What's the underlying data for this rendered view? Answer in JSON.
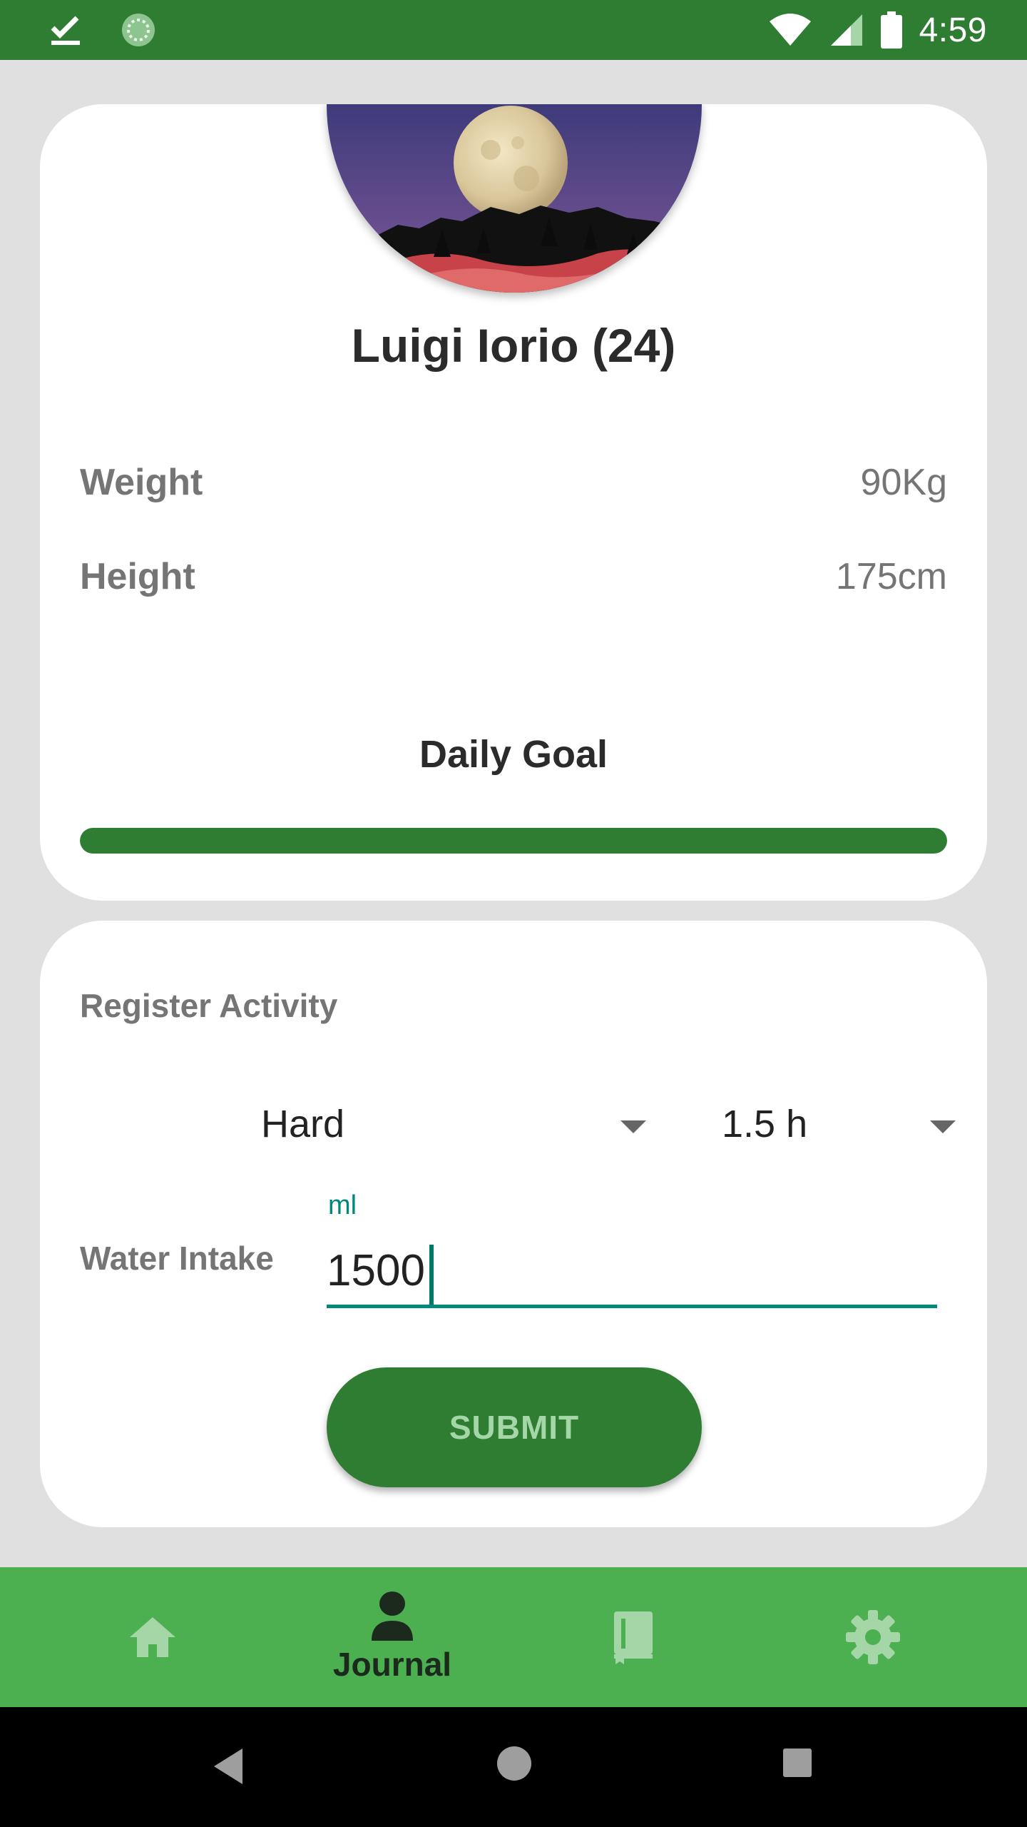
{
  "status_bar": {
    "time": "4:59",
    "icons": [
      "check-notification-icon",
      "sync-icon",
      "wifi-icon",
      "cellular-signal-icon",
      "battery-icon"
    ]
  },
  "profile": {
    "name": "Luigi Iorio (24)",
    "weight_label": "Weight",
    "weight_value": "90Kg",
    "height_label": "Height",
    "height_value": "175cm",
    "daily_goal_label": "Daily Goal",
    "daily_goal_progress": 1.0
  },
  "activity": {
    "title": "Register Activity",
    "intensity_selected": "Hard",
    "duration_selected": "1.5 h",
    "water_label": "Water Intake",
    "water_unit_label": "ml",
    "water_value": "1500",
    "submit_label": "SUBMIT"
  },
  "bottom_nav": {
    "items": [
      {
        "icon": "home-icon",
        "label": ""
      },
      {
        "icon": "person-icon",
        "label": "Journal",
        "selected": true
      },
      {
        "icon": "book-icon",
        "label": ""
      },
      {
        "icon": "gear-icon",
        "label": ""
      }
    ]
  },
  "colors": {
    "primary_dark": "#2e7d32",
    "primary": "#4caf50",
    "accent": "#00897b",
    "background": "#e0e0e0"
  }
}
